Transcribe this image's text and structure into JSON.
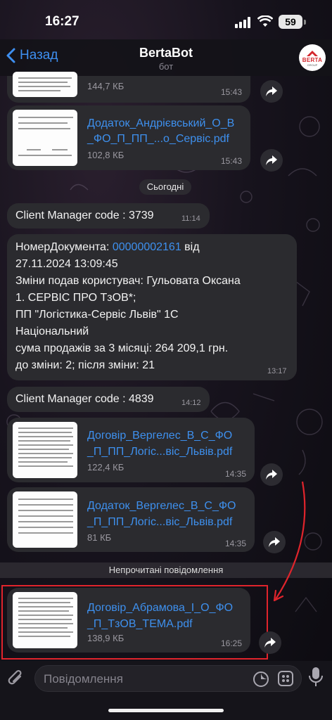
{
  "status_bar": {
    "time": "16:27",
    "battery": "59"
  },
  "header": {
    "back_label": "Назад",
    "title": "BertaBot",
    "subtitle": "бот",
    "avatar_text": "BERTA",
    "avatar_subtext": "GROUP"
  },
  "messages": {
    "file_top": {
      "size": "144,7 КБ",
      "time": "15:43"
    },
    "file_andriivskyi": {
      "name_line1": "Додаток_Андрієвський_О_В",
      "name_line2": "_ФО_П_ПП_...о_Сервіс.pdf",
      "size": "102,8 КБ",
      "time": "15:43"
    },
    "date_separator": "Сьогодні",
    "code1": {
      "text": "Client Manager code : 3739",
      "time": "11:14"
    },
    "doc_notice": {
      "line1_prefix": "НомерДокумента: ",
      "doc_number": "00000002161",
      "line1_suffix": " від",
      "line2": "27.11.2024 13:09:45",
      "line3": "Зміни подав користувач: Гульовата Оксана",
      "line4": "1. СЕРВІС ПРО ТзОВ*;",
      "line5": "ПП \"Логістика-Сервіс Львів\" 1С",
      "line6": "Національний",
      "line7": "сума продажів за 3 місяці: 264 209,1 грн.",
      "line8": "до зміни: 2;  після зміни: 21",
      "time": "13:17"
    },
    "code2": {
      "text": "Client Manager code : 4839",
      "time": "14:12"
    },
    "file_dogovir_vergeles": {
      "name_line1": "Договір_Вергелес_В_С_ФО",
      "name_line2": "_П_ПП_Логіс...віс_Львів.pdf",
      "size": "122,4 КБ",
      "time": "14:35"
    },
    "file_dodatok_vergeles": {
      "name_line1": "Додаток_Вергелес_В_С_ФО",
      "name_line2": "_П_ПП_Логіс...віс_Львів.pdf",
      "size": "81 КБ",
      "time": "14:35"
    },
    "unread_separator": "Непрочитані повідомлення",
    "file_abramova": {
      "name_line1": "Договір_Абрамова_І_О_ФО",
      "name_line2": "_П_ТзОВ_ТЕМА.pdf",
      "size": "138,9 КБ",
      "time": "16:25"
    }
  },
  "composer": {
    "placeholder": "Повідомлення"
  },
  "icons": [
    "back-chevron-icon",
    "share-icon",
    "attach-icon",
    "sticker-icon",
    "keyboard-icon",
    "mic-icon"
  ],
  "colors": {
    "accent": "#3e90ee",
    "highlight_box": "#e0242c",
    "bubble": "#2b2b2f"
  }
}
